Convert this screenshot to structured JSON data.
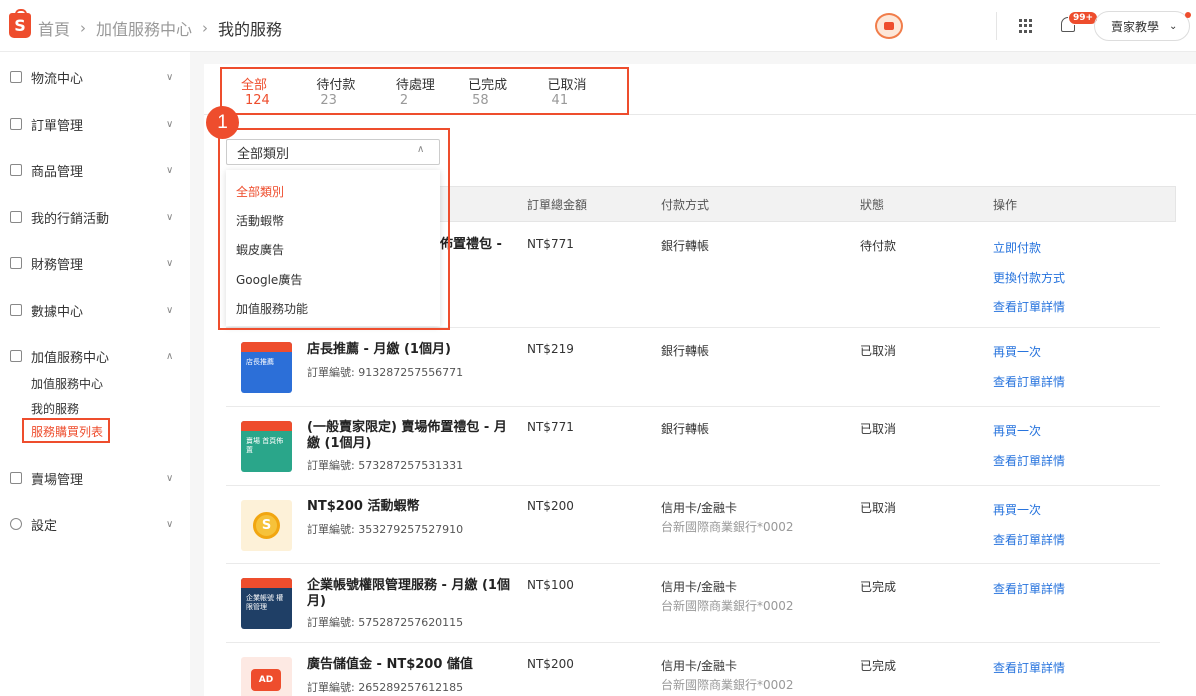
{
  "header": {
    "logo_text": "S",
    "breadcrumb": [
      "首頁",
      "加值服務中心",
      "我的服務"
    ],
    "notification_badge": "99+",
    "user_label": "賣家教學",
    "colors": {
      "brand": "#ee4d2d",
      "link": "#2673dd"
    }
  },
  "sidebar": {
    "items": [
      {
        "label": "物流中心",
        "icon": "truck-icon"
      },
      {
        "label": "訂單管理",
        "icon": "document-icon"
      },
      {
        "label": "商品管理",
        "icon": "box-icon"
      },
      {
        "label": "我的行銷活動",
        "icon": "tag-icon"
      },
      {
        "label": "財務管理",
        "icon": "wallet-icon"
      },
      {
        "label": "數據中心",
        "icon": "chart-icon"
      },
      {
        "label": "加值服務中心",
        "icon": "diamond-icon"
      },
      {
        "label": "賣場管理",
        "icon": "shop-icon"
      },
      {
        "label": "設定",
        "icon": "gear-icon"
      }
    ],
    "sub_items": [
      "加值服務中心",
      "我的服務",
      "服務購買列表"
    ]
  },
  "tabs": [
    {
      "label": "全部",
      "count": "124"
    },
    {
      "label": "待付款",
      "count": "23"
    },
    {
      "label": "待處理",
      "count": "2"
    },
    {
      "label": "已完成",
      "count": "58"
    },
    {
      "label": "已取消",
      "count": "41"
    }
  ],
  "step_marker": "1",
  "category_select": {
    "value": "全部類別",
    "options": [
      "全部類別",
      "活動蝦幣",
      "蝦皮廣告",
      "Google廣告",
      "加值服務功能"
    ]
  },
  "table": {
    "headers": [
      "訂單總金額",
      "付款方式",
      "狀態",
      "操作"
    ],
    "rows": [
      {
        "name_partial": "佈置禮包 -",
        "amount": "NT$771",
        "payment": "銀行轉帳",
        "payment_sub": "",
        "status": "待付款",
        "actions": [
          "立即付款",
          "更換付款方式",
          "查看訂單詳情"
        ]
      },
      {
        "name": "店長推薦 - 月繳 (1個月)",
        "order_id": "訂單編號: 913287257556771",
        "thumb_text": "店長推薦",
        "amount": "NT$219",
        "payment": "銀行轉帳",
        "payment_sub": "",
        "status": "已取消",
        "actions": [
          "再買一次",
          "查看訂單詳情"
        ]
      },
      {
        "name": "(一般賣家限定) 賣場佈置禮包 - 月繳 (1個月)",
        "order_id": "訂單編號: 573287257531331",
        "thumb_text": "賣場 首頁佈置",
        "amount": "NT$771",
        "payment": "銀行轉帳",
        "payment_sub": "",
        "status": "已取消",
        "actions": [
          "再買一次",
          "查看訂單詳情"
        ]
      },
      {
        "name": "NT$200 活動蝦幣",
        "order_id": "訂單編號: 353279257527910",
        "thumb_text": "S",
        "amount": "NT$200",
        "payment": "信用卡/金融卡",
        "payment_sub": "台新國際商業銀行*0002",
        "status": "已取消",
        "actions": [
          "再買一次",
          "查看訂單詳情"
        ]
      },
      {
        "name": "企業帳號權限管理服務 - 月繳 (1個月)",
        "order_id": "訂單編號: 575287257620115",
        "thumb_text": "企業帳號 權限管理",
        "amount": "NT$100",
        "payment": "信用卡/金融卡",
        "payment_sub": "台新國際商業銀行*0002",
        "status": "已完成",
        "actions": [
          "查看訂單詳情"
        ]
      },
      {
        "name": "廣告儲值金 - NT$200 儲值",
        "order_id": "訂單編號: 265289257612185",
        "thumb_text": "AD",
        "amount": "NT$200",
        "payment": "信用卡/金融卡",
        "payment_sub": "台新國際商業銀行*0002",
        "status": "已完成",
        "actions": [
          "查看訂單詳情"
        ]
      }
    ]
  }
}
